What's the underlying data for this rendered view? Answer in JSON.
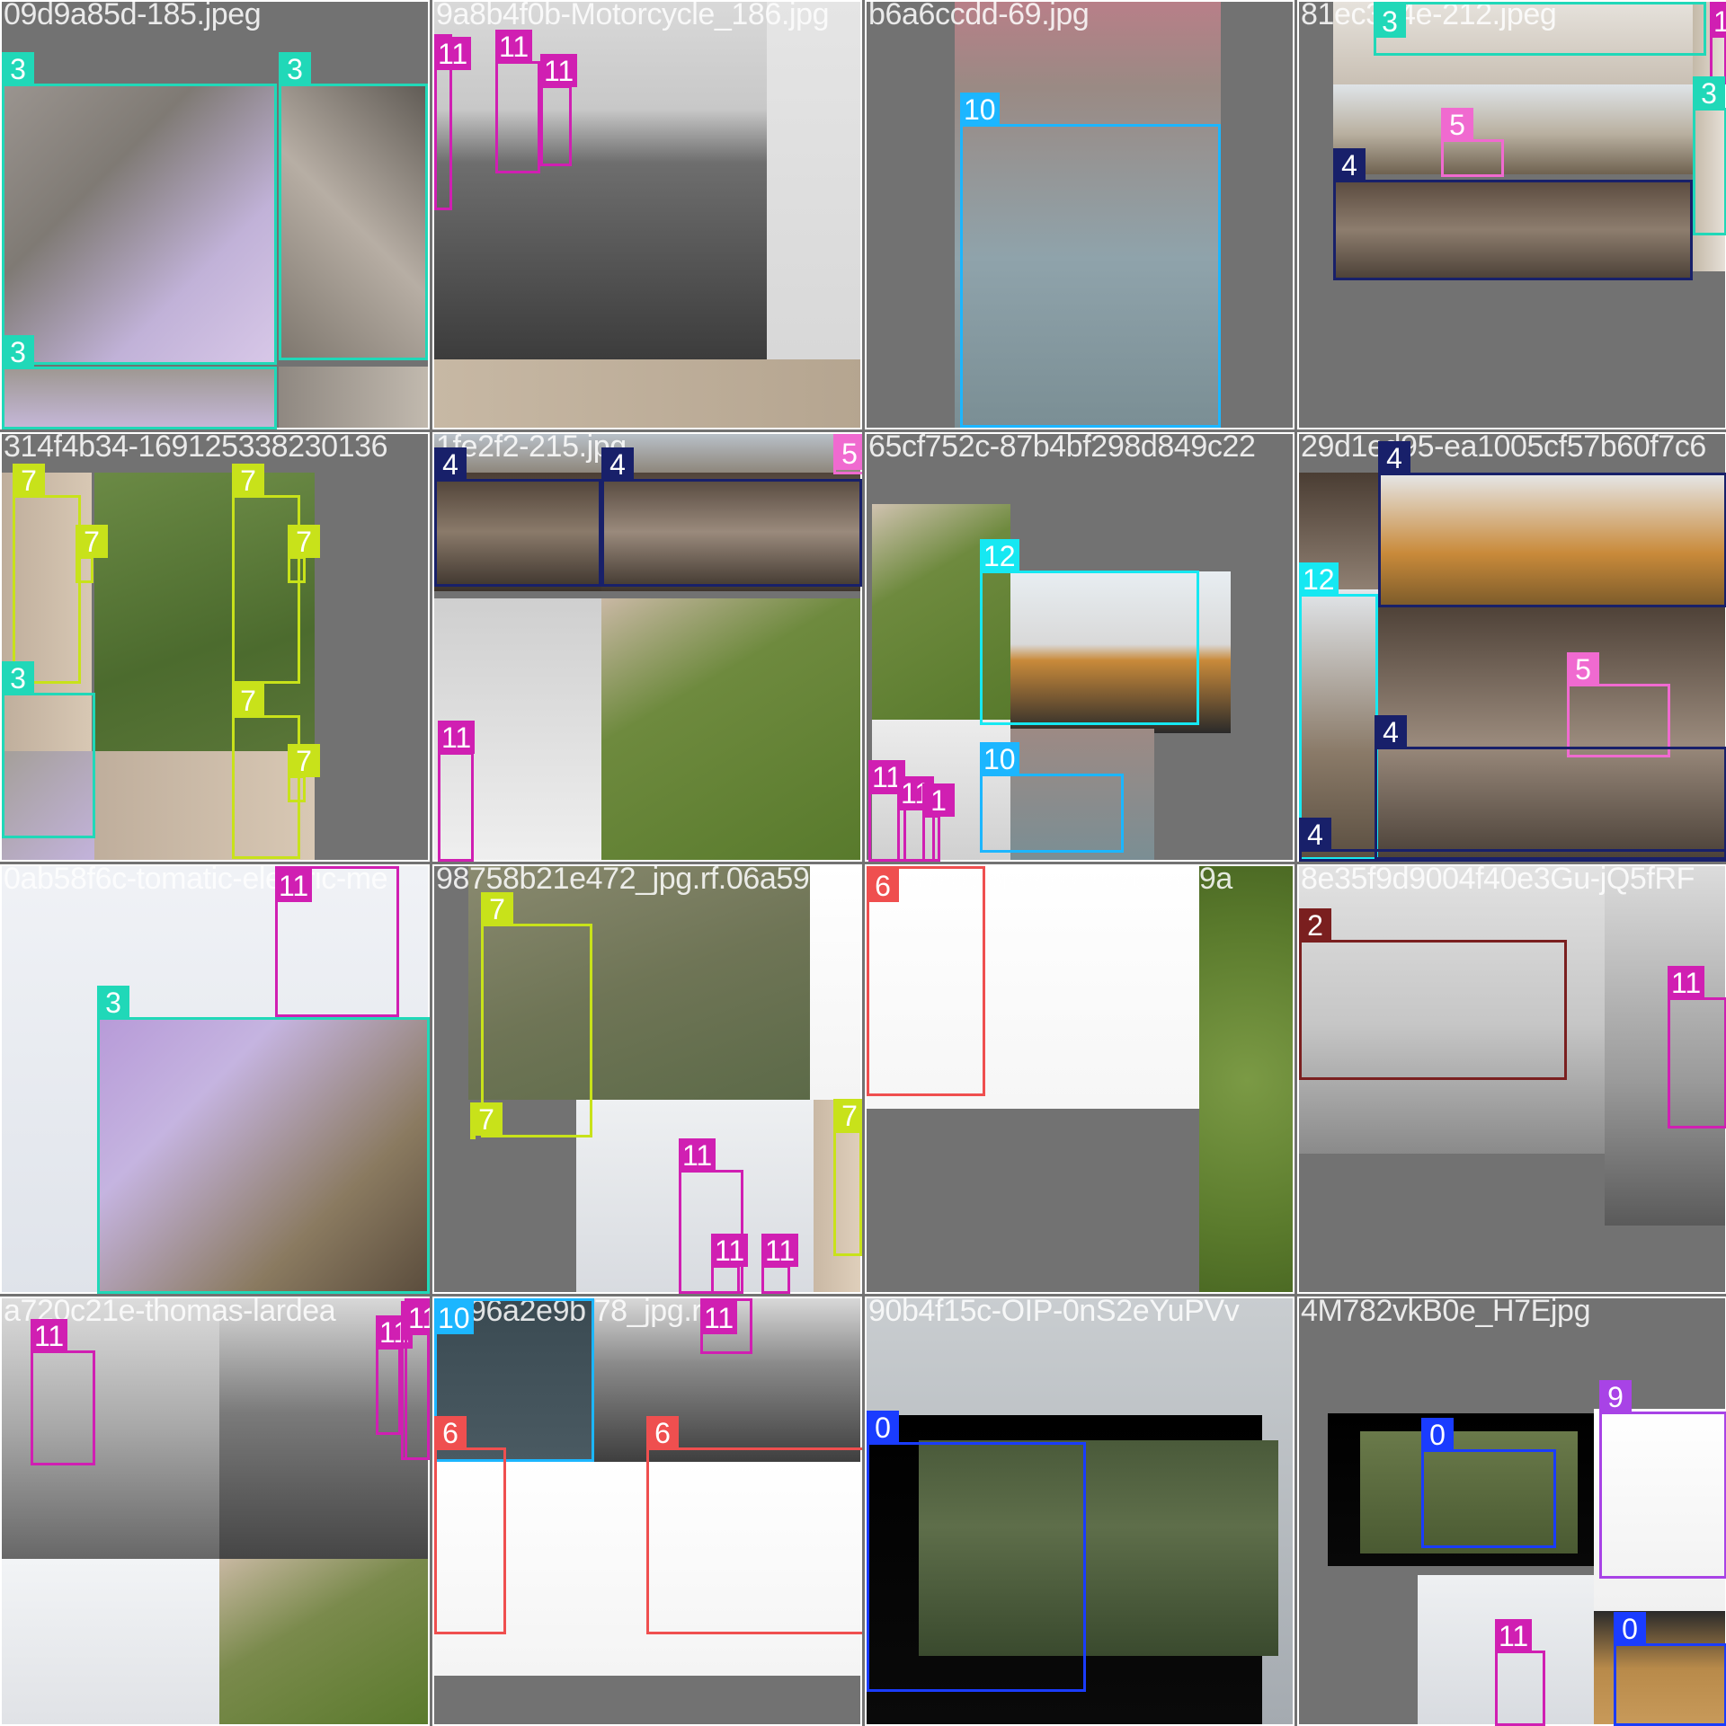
{
  "class_colors": {
    "0": "#1a3cff",
    "2": "#7a1f1f",
    "3": "#20d8b8",
    "4": "#18206a",
    "5": "#f06ad0",
    "6": "#ef4f4f",
    "7": "#c8e21a",
    "9": "#a843e6",
    "10": "#1cb6ff",
    "11": "#d01fb2",
    "12": "#16e8f2"
  },
  "mosaic": {
    "tiles": [
      {
        "label": "09d9a85d-185.jpeg",
        "regions": [
          {
            "fill": "linear-gradient(135deg,#9b9590 0%,#7f7a74 35%,#c1b2d8 70%,#d8c8e8 100%)"
          },
          {
            "fill": "linear-gradient(45deg,#7d766d,#b7aea4 50%,#5f5a54)"
          },
          {
            "fill": "linear-gradient(180deg,#9d9790,#c6b8da)"
          },
          {
            "fill": "linear-gradient(90deg,#8f8881,#c1b9ae)"
          }
        ],
        "boxes": [
          {
            "cls": "3",
            "label": "3"
          },
          {
            "cls": "3",
            "label": "3"
          },
          {
            "cls": "3",
            "label": "3"
          }
        ]
      },
      {
        "label": "9a8b4f0b-Motorcycle_186.jpg",
        "regions": [
          {
            "fill": "linear-gradient(180deg,#d9d9d9 0%,#c8c8c8 30%,#6e6e6e 45%,#3c3c3c 100%)"
          },
          {
            "fill": "linear-gradient(180deg,#e5e5e5,#d8d8d8)"
          },
          {
            "fill": "linear-gradient(90deg,#c7b8a4,#b5a590)"
          }
        ],
        "boxes": [
          {
            "cls": "11",
            "label": "11"
          },
          {
            "cls": "11",
            "label": "11"
          },
          {
            "cls": "11",
            "label": "11"
          }
        ]
      },
      {
        "label": "b6a6ccdd-69.jpg",
        "regions": [
          {
            "fill": "linear-gradient(180deg,#b87f88 0%,#9a8a84 20%,#8fa3ab 60%,#7a8e94 100%)"
          }
        ],
        "boxes": [
          {
            "cls": "10",
            "label": "10"
          }
        ]
      },
      {
        "label": "81ec374e-212.jpeg",
        "regions": [
          {
            "fill": "linear-gradient(180deg,#e6e2dc,#c9c0b4)"
          },
          {
            "fill": "linear-gradient(180deg,#dfe4e8 0%,#b9b0a0 55%,#6f6250 100%)"
          },
          {
            "fill": "linear-gradient(180deg,#5a4a3e,#8d7d6e 50%,#4a3f36)"
          },
          {
            "fill": "linear-gradient(90deg,#c4b9a8,#e8e2da)"
          }
        ],
        "boxes": [
          {
            "cls": "3",
            "label": "3"
          },
          {
            "cls": "11",
            "label": "11"
          },
          {
            "cls": "3",
            "label": "3"
          },
          {
            "cls": "5",
            "label": "5"
          },
          {
            "cls": "4",
            "label": "4"
          }
        ]
      },
      {
        "label": "314f4b34-169125338230136",
        "regions": [
          {
            "fill": "linear-gradient(90deg,#bfae9c,#d8c8b4)"
          },
          {
            "fill": "linear-gradient(160deg,#6b8a45,#4c6b2e 60%,#5a7638)"
          },
          {
            "fill": "linear-gradient(90deg,#bfae9c,#d8c8b4)"
          },
          {
            "fill": "linear-gradient(135deg,#a49f99,#c3b3dc)"
          },
          {
            "fill": "linear-gradient(160deg,#6b8a45,#4c6b2e 60%,#5a7638)"
          }
        ],
        "boxes": [
          {
            "cls": "7",
            "label": "7"
          },
          {
            "cls": "7",
            "label": "7"
          },
          {
            "cls": "7",
            "label": "7"
          },
          {
            "cls": "7",
            "label": "7"
          },
          {
            "cls": "3",
            "label": "3"
          },
          {
            "cls": "7",
            "label": "7"
          },
          {
            "cls": "7",
            "label": "7"
          }
        ]
      },
      {
        "label": "1fe2f2-215.jpg",
        "regions": [
          {
            "fill": "linear-gradient(180deg,#b8c0c8,#8c8478)"
          },
          {
            "fill": "linear-gradient(180deg,#4a3d33,#8a7a6a 50%,#3a312a)"
          },
          {
            "fill": "linear-gradient(180deg,#4f4238,#9a8a7c 50%,#3d342c)"
          },
          {
            "fill": "linear-gradient(180deg,#cfcfcf,#efefef)"
          },
          {
            "fill": "linear-gradient(150deg,#c9b8a4 0%,#6e8a3e 35%,#587a2c 100%)"
          }
        ],
        "boxes": [
          {
            "cls": "5",
            "label": "5"
          },
          {
            "cls": "4",
            "label": "4"
          },
          {
            "cls": "4",
            "label": "4"
          },
          {
            "cls": "11",
            "label": "11"
          }
        ]
      },
      {
        "label": "65cf752c-87b4bf298d849c22",
        "regions": [
          {
            "fill": "linear-gradient(150deg,#d0c2b0 0%,#6e8a3e 35%,#587a2c 100%)"
          },
          {
            "fill": "linear-gradient(180deg,#e8eef2 0%,#d9d9d9 45%,#c98a3a 55%,#2a2a2a 100%)"
          },
          {
            "fill": "linear-gradient(180deg,#ececec,#d0d0d0)"
          },
          {
            "fill": "linear-gradient(180deg,#9d8a84,#7a8e94)"
          }
        ],
        "boxes": [
          {
            "cls": "12",
            "label": "12"
          },
          {
            "cls": "10",
            "label": "10"
          },
          {
            "cls": "11",
            "label": "11"
          },
          {
            "cls": "11",
            "label": "11"
          },
          {
            "cls": "11",
            "label": "1"
          }
        ]
      },
      {
        "label": "29d1ed95-ea1005cf57b60f7c6",
        "regions": [
          {
            "fill": "linear-gradient(180deg,#4a3d33,#9a8a7c 50%,#3a312a)"
          },
          {
            "fill": "linear-gradient(180deg,#e6e8ea,#c98a3a 60%,#7a5a2a)"
          },
          {
            "fill": "linear-gradient(180deg,#e2e6ea 0%,#8a7a68 60%,#5a4e40 100%)"
          },
          {
            "fill": "linear-gradient(180deg,#4f4238,#9a8a7c 50%,#3d342c)"
          }
        ],
        "boxes": [
          {
            "cls": "4",
            "label": "4"
          },
          {
            "cls": "12",
            "label": "12"
          },
          {
            "cls": "5",
            "label": "5"
          },
          {
            "cls": "4",
            "label": "4"
          },
          {
            "cls": "4",
            "label": "4"
          }
        ]
      },
      {
        "label": "0ab58f6c-tomatic-electric-me",
        "regions": [
          {
            "fill": "linear-gradient(180deg,#f0f2f6,#dfe3ea)"
          },
          {
            "fill": "linear-gradient(135deg,#b79ad8 0%,#c5b4e0 30%,#8a7a60 70%,#5a4c3c 100%)"
          }
        ],
        "boxes": [
          {
            "cls": "11",
            "label": "11"
          },
          {
            "cls": "3",
            "label": "3"
          }
        ]
      },
      {
        "label": "98758b21e472_jpg.rf.06a59",
        "regions": [
          {
            "fill": "linear-gradient(160deg,#8a8a70,#6f7556 50%,#5c6a48)"
          },
          {
            "fill": "linear-gradient(180deg,#ffffff,#f4f4f4)"
          },
          {
            "fill": "linear-gradient(180deg,#eef0f2,#d8dbe0)"
          },
          {
            "fill": "linear-gradient(90deg,#c9b8a4,#e0d0bc)"
          }
        ],
        "boxes": [
          {
            "cls": "7",
            "label": "7"
          },
          {
            "cls": "11",
            "label": "11"
          },
          {
            "cls": "7",
            "label": "7"
          },
          {
            "cls": "7",
            "label": "7"
          },
          {
            "cls": "11",
            "label": "11"
          },
          {
            "cls": "11",
            "label": "11"
          }
        ]
      },
      {
        "label": "a2e82d56f3970 1c7b9839a",
        "regions": [
          {
            "fill": "linear-gradient(180deg,#ffffff,#f6f6f6)"
          },
          {
            "fill": "radial-gradient(circle,#7b9a45,#5a7a2c 70%,#4c6a24)"
          }
        ],
        "boxes": [
          {
            "cls": "6",
            "label": "6"
          }
        ]
      },
      {
        "label": "8e35f9d9004f40e3Gu-jQ5fRF",
        "regions": [
          {
            "fill": "linear-gradient(180deg,#e2e2e2 0%,#c6c6c6 55%,#8a8a8a 100%)"
          },
          {
            "fill": "linear-gradient(180deg,#dcdcdc,#9a9a9a 60%,#5a5a5a)"
          }
        ],
        "boxes": [
          {
            "cls": "2",
            "label": "2"
          },
          {
            "cls": "11",
            "label": "11"
          }
        ]
      },
      {
        "label": "a720c21e-thomas-lardea",
        "regions": [
          {
            "fill": "linear-gradient(180deg,#dcdcdc 0%,#a8a8a8 45%,#5a5a5a 100%)"
          },
          {
            "fill": "linear-gradient(180deg,#d8d8d8 0%,#7a7a7a 40%,#3c3c3c 100%)"
          },
          {
            "fill": "linear-gradient(180deg,#f2f4f6,#e0e2e6)"
          },
          {
            "fill": "linear-gradient(150deg,#c8b8a2 0%,#7a8a4c 40%,#5a7a2c 100%)"
          }
        ],
        "boxes": [
          {
            "cls": "11",
            "label": "11"
          },
          {
            "cls": "11",
            "label": "11"
          },
          {
            "cls": "11",
            "label": "11"
          },
          {
            "cls": "11",
            "label": "11"
          }
        ]
      },
      {
        "label": "1296a2e9b 78_jpg.rf",
        "regions": [
          {
            "fill": "linear-gradient(180deg,#3a4a52,#4a5a62)"
          },
          {
            "fill": "linear-gradient(180deg,#d8d8d8 0%,#8a8a8a 40%,#3f3f3f 100%)"
          },
          {
            "fill": "linear-gradient(180deg,#ffffff,#f4f4f4)"
          }
        ],
        "boxes": [
          {
            "cls": "10",
            "label": "10"
          },
          {
            "cls": "11",
            "label": "11"
          },
          {
            "cls": "6",
            "label": "6"
          },
          {
            "cls": "6",
            "label": "6"
          }
        ]
      },
      {
        "label": "90b4f15c-OIP-0nS2eYuPVv",
        "regions": [
          {
            "fill": "linear-gradient(180deg,#c9cdd0,#a4aab0)"
          },
          {
            "fill": "linear-gradient(180deg,#000000,#0a0a0a)"
          },
          {
            "fill": "linear-gradient(180deg,#4a5a3a 0%,#5e6e4a 40%,#3a4a2e 100%)"
          }
        ],
        "boxes": [
          {
            "cls": "0",
            "label": "0"
          }
        ]
      },
      {
        "label": "4M782vkB0e_H7Ejpg",
        "regions": [
          {
            "fill": "linear-gradient(180deg,#000000,#080808)"
          },
          {
            "fill": "linear-gradient(180deg,#6a7a4a,#4a5a32)"
          },
          {
            "fill": "linear-gradient(180deg,#ffffff,#f0f0f0)"
          },
          {
            "fill": "linear-gradient(180deg,#eef0f2,#d8dbe0)"
          },
          {
            "fill": "linear-gradient(180deg,#2a2a2a,#b88a4a 50%,#c89a5a)"
          }
        ],
        "boxes": [
          {
            "cls": "9",
            "label": "9"
          },
          {
            "cls": "0",
            "label": "0"
          },
          {
            "cls": "11",
            "label": "11"
          },
          {
            "cls": "0",
            "label": "0"
          }
        ]
      }
    ]
  }
}
